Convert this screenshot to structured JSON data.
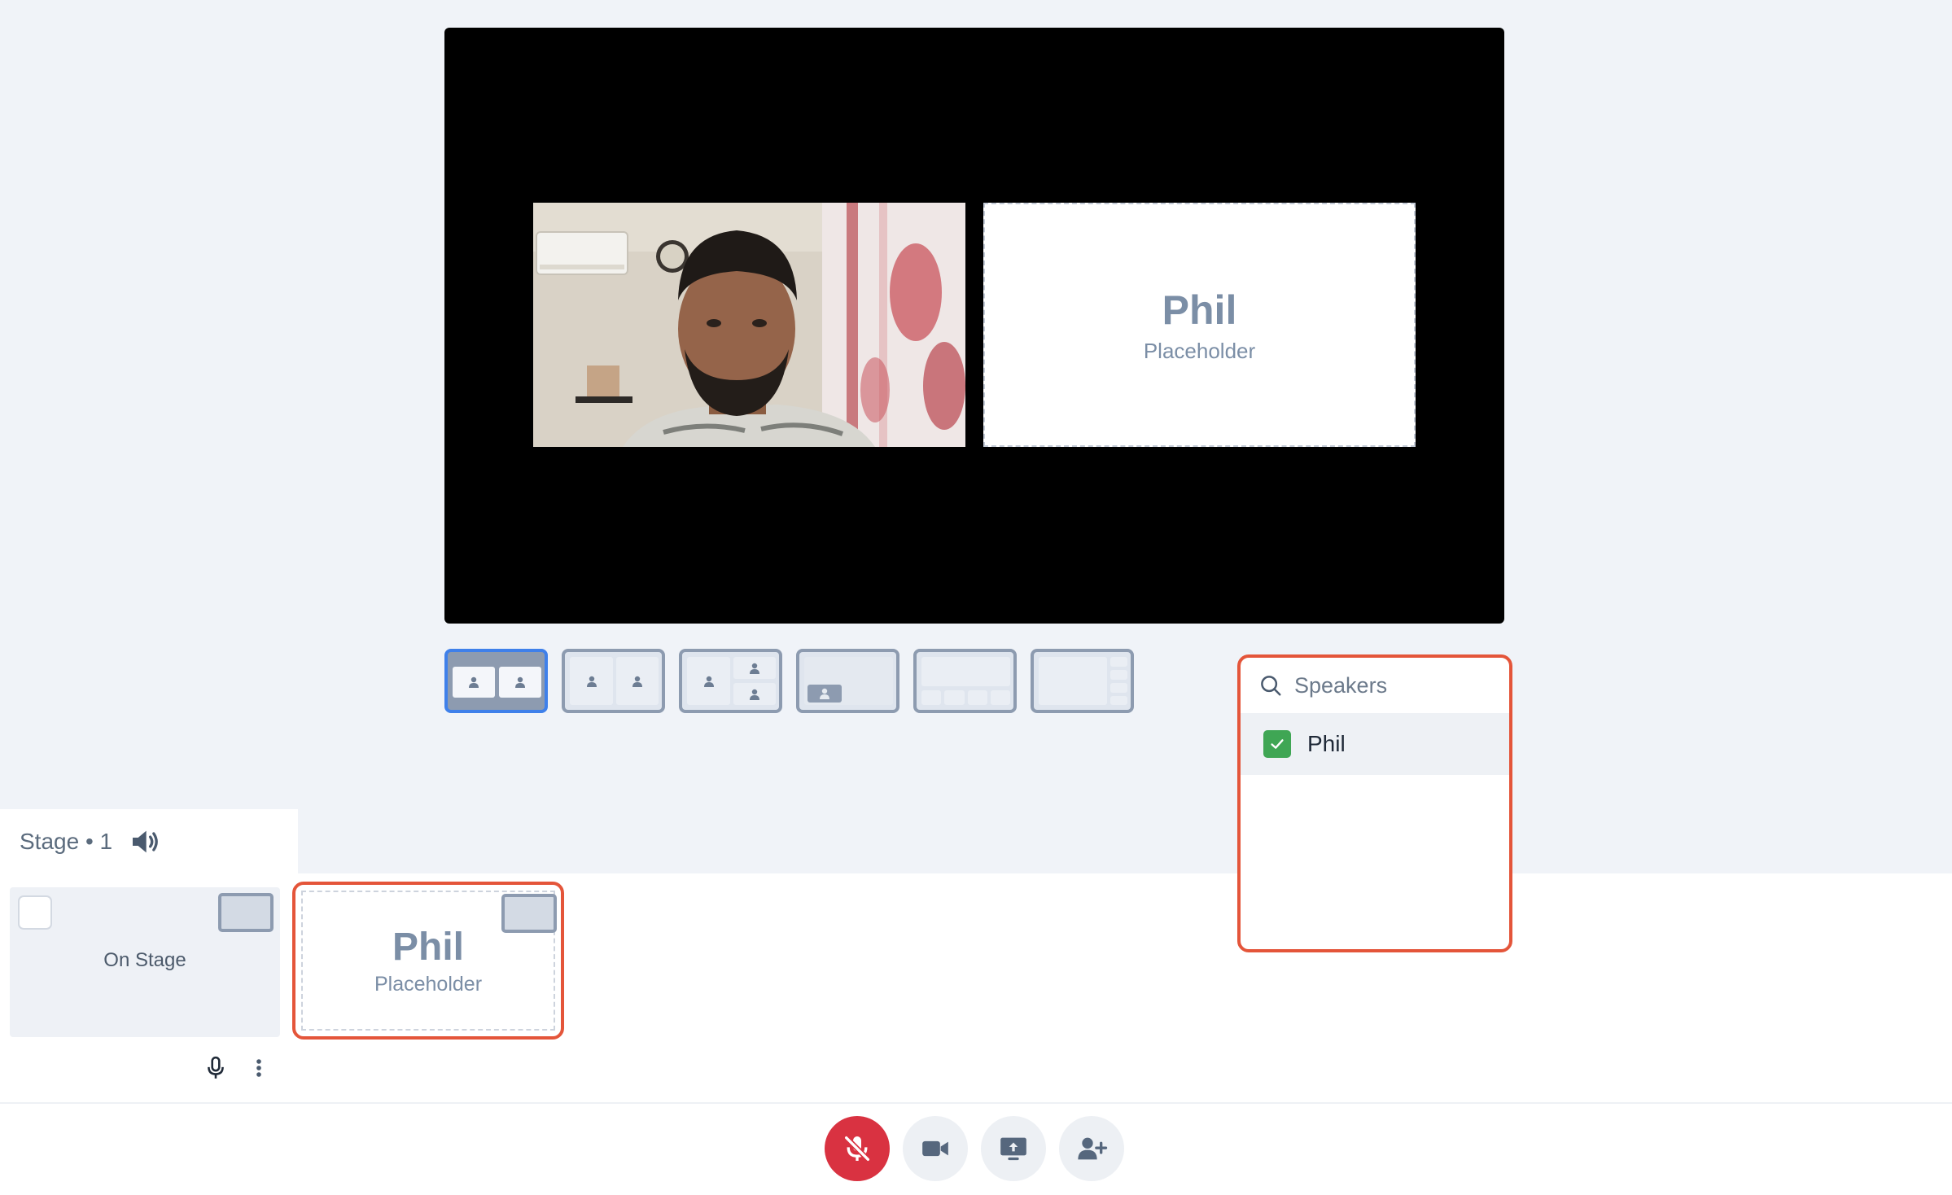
{
  "preview": {
    "placeholder_name": "Phil",
    "placeholder_subtitle": "Placeholder"
  },
  "layouts": [
    {
      "id": "two-side-by-side",
      "selected": true
    },
    {
      "id": "two-equal",
      "selected": false
    },
    {
      "id": "one-plus-two",
      "selected": false
    },
    {
      "id": "presenter-screen",
      "selected": false
    },
    {
      "id": "main-plus-bottom-strip",
      "selected": false
    },
    {
      "id": "main-plus-side-strip",
      "selected": false
    }
  ],
  "speakers_popup": {
    "search_placeholder": "Speakers",
    "items": [
      {
        "name": "Phil",
        "checked": true
      }
    ]
  },
  "stage_panel": {
    "title": "Stage • 1",
    "on_stage_label": "On Stage"
  },
  "phil_card": {
    "name": "Phil",
    "subtitle": "Placeholder"
  },
  "controls": [
    {
      "id": "mic",
      "icon": "mic-off-icon",
      "muted": true
    },
    {
      "id": "camera",
      "icon": "camera-icon"
    },
    {
      "id": "screen-share",
      "icon": "screen-share-icon"
    },
    {
      "id": "invite",
      "icon": "add-user-icon"
    }
  ],
  "colors": {
    "accent_selected": "#3f80ea",
    "highlight_border": "#e4553a",
    "mic_muted": "#d93241",
    "check_green": "#3fa654"
  }
}
